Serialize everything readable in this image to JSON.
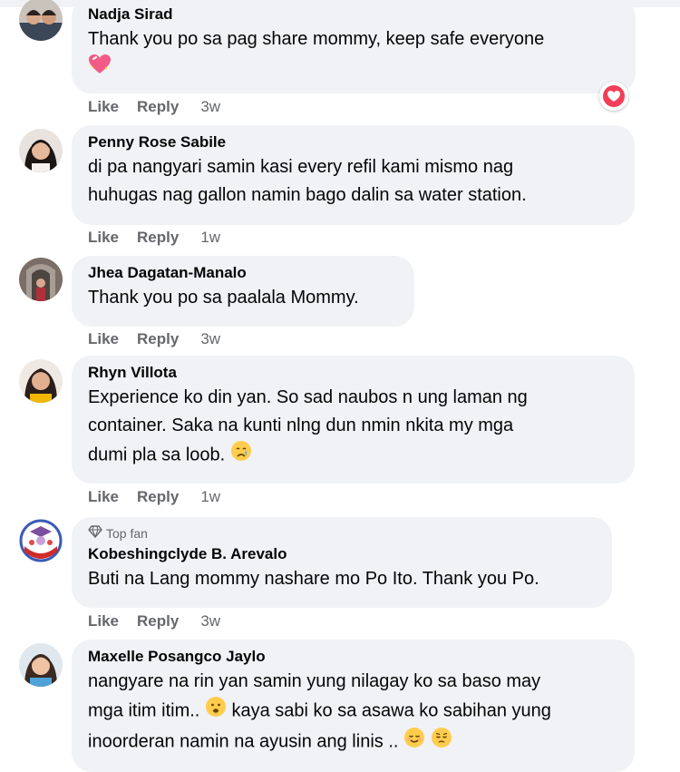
{
  "colors": {
    "bubble_bg": "#f0f2f5",
    "secondary_text": "#65676b",
    "love_reaction": "#f33e58"
  },
  "labels": {
    "like": "Like",
    "reply": "Reply"
  },
  "comments": [
    {
      "author": "Nadja Sirad",
      "text": "Thank you po sa pag share mommy, keep safe everyone",
      "emoji": "sparkling-heart",
      "time": "3w",
      "reaction": "love-reaction-icon"
    },
    {
      "author": "Penny Rose Sabile",
      "text_lines": [
        "di pa nangyari samin kasi every refil kami mismo nag",
        "huhugas nag gallon namin bago dalin sa water station."
      ],
      "time": "1w"
    },
    {
      "author": "Jhea Dagatan-Manalo",
      "text": "Thank you po sa paalala Mommy.",
      "time": "3w"
    },
    {
      "author": "Rhyn Villota",
      "text_lines": [
        "Experience ko din yan. So sad naubos n ung laman ng",
        "container. Saka na kunti nlng dun nmin nkita my mga",
        "dumi pla sa loob."
      ],
      "emoji": "crying-face",
      "time": "1w"
    },
    {
      "author": "Kobeshingclyde B. Arevalo",
      "badge": "Top fan",
      "text": "Buti na Lang mommy nashare mo Po Ito. Thank you Po.",
      "time": "3w"
    },
    {
      "author": "Maxelle Posangco Jaylo",
      "text_lines": [
        "nangyare na rin yan samin yung nilagay ko sa baso may",
        "mga itim itim..",
        "kaya sabi ko sa asawa ko sabihan yung",
        "inoorderan namin na ayusin ang linis .."
      ],
      "emoji": "worried-face, relieved-face, pensive-face"
    }
  ]
}
